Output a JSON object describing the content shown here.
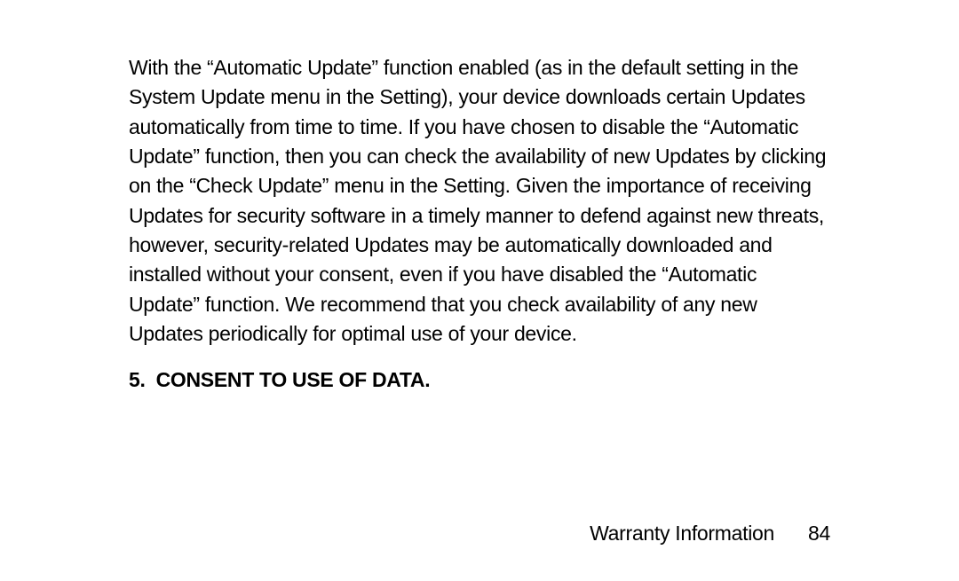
{
  "body_paragraph": "With the “Automatic Update” function enabled (as in the default setting in the System Update menu in the Setting), your device downloads certain Updates automatically from time to time. If you have chosen  to disable the “Automatic Update” function, then you can check the availability of new Updates by clicking on the “Check Update” menu in the Setting.  Given the importance of receiving Updates for security software in a timely manner to defend against new threats, however, security-related Updates may be automatically downloaded and installed without your consent, even if you have disabled the “Automatic Update” function. We recommend that you check availability of any new Updates periodically for optimal use of your device.",
  "section": {
    "number": "5.",
    "title": "CONSENT TO USE OF DATA",
    "suffix": "."
  },
  "footer": {
    "label": "Warranty Information",
    "page": "84"
  }
}
